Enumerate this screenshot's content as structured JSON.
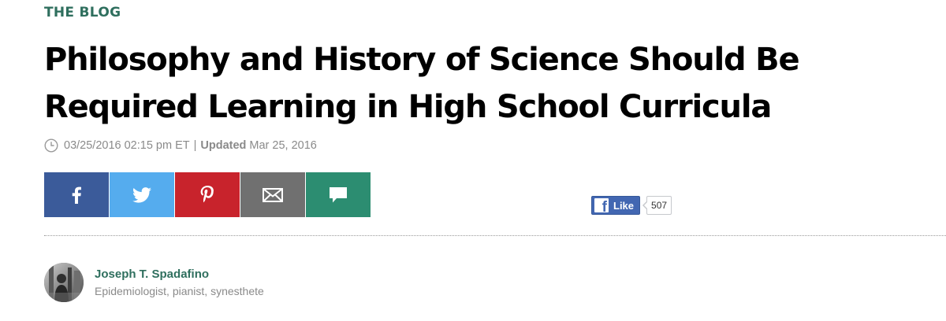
{
  "section": {
    "label": "THE BLOG",
    "color": "#2f6f5e"
  },
  "article": {
    "title": "Philosophy and History of Science Should Be Required Learning in High School Curricula",
    "published": "03/25/2016 02:15 pm ET",
    "separator": "|",
    "updated_label": "Updated",
    "updated_date": "Mar 25, 2016"
  },
  "share": {
    "buttons": [
      {
        "name": "facebook",
        "icon": "facebook-icon",
        "color": "#3b5b9a"
      },
      {
        "name": "twitter",
        "icon": "twitter-icon",
        "color": "#55acee"
      },
      {
        "name": "pinterest",
        "icon": "pinterest-icon",
        "color": "#c8232c"
      },
      {
        "name": "email",
        "icon": "envelope-icon",
        "color": "#707070"
      },
      {
        "name": "comment",
        "icon": "speech-bubble-icon",
        "color": "#2c8d71"
      }
    ]
  },
  "facebook_like": {
    "label": "Like",
    "count": "507"
  },
  "author": {
    "name": "Joseph T. Spadafino",
    "bio": "Epidemiologist, pianist, synesthete"
  }
}
